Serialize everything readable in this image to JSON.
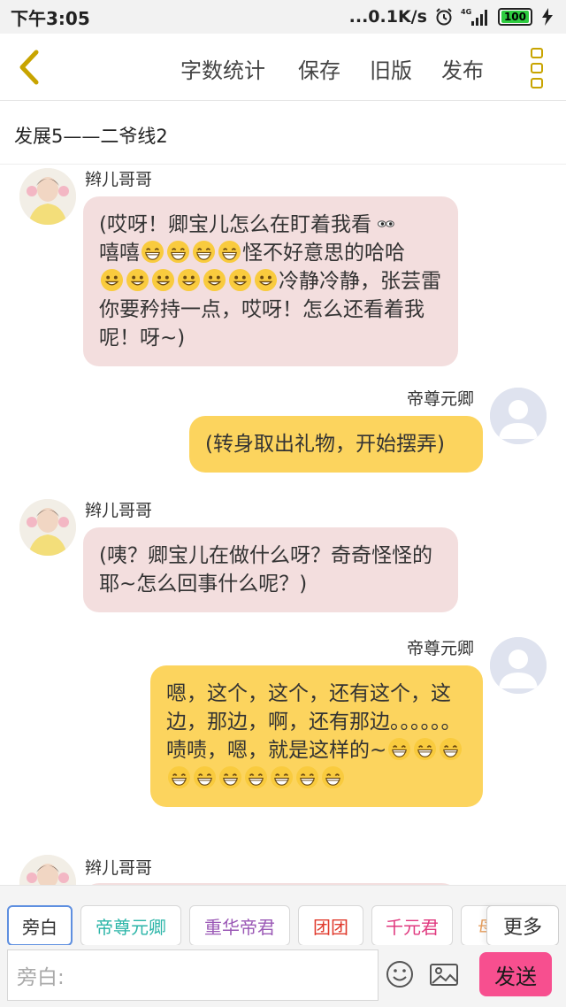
{
  "status_bar": {
    "time": "下午3:05",
    "network_speed": "...0.1K/s",
    "network_type": "4G",
    "battery": "100",
    "icons": [
      "alarm-icon",
      "signal-icon",
      "battery-icon",
      "charging-icon"
    ]
  },
  "toolbar": {
    "back_icon": "chevron-left-icon",
    "items": [
      "字数统计",
      "保存",
      "旧版",
      "发布"
    ],
    "more_icon": "more-vertical-icon"
  },
  "chapter": {
    "title": "发展5——二爷线2"
  },
  "messages": [
    {
      "side": "left",
      "sender": "辫儿哥哥",
      "avatar": "avatar-photo",
      "text_parts": [
        "(哎呀！卿宝儿怎么在盯着我看",
        "👀",
        "嘻嘻",
        "😁😁😁😁",
        "怪不好意思的哈哈",
        "😊😊😊😊😊😊😊",
        "冷静冷静，张芸雷你要矜持一点，哎呀！怎么还看着我呢！呀~)"
      ]
    },
    {
      "side": "right",
      "sender": "帝尊元卿",
      "avatar": "avatar-default",
      "text": "(转身取出礼物，开始摆弄)"
    },
    {
      "side": "left",
      "sender": "辫儿哥哥",
      "avatar": "avatar-photo",
      "text": "(咦？卿宝儿在做什么呀？奇奇怪怪的耶~怎么回事什么呢？)"
    },
    {
      "side": "right",
      "sender": "帝尊元卿",
      "avatar": "avatar-default",
      "text_parts": [
        "嗯，这个，这个，还有这个，这边，那边，啊，还有那边。。。。。。啧啧，嗯，就是这样的~",
        "😁😁😁😁😁😁😁😁😁😁"
      ]
    },
    {
      "side": "left",
      "sender": "辫儿哥哥",
      "avatar": "avatar-photo",
      "text": ""
    }
  ],
  "speakers": [
    {
      "label": "旁白",
      "color": "#333333",
      "active": true
    },
    {
      "label": "帝尊元卿",
      "color": "#2bb5a8",
      "active": false
    },
    {
      "label": "重华帝君",
      "color": "#9b59b6",
      "active": false
    },
    {
      "label": "团团",
      "color": "#e0392b",
      "active": false
    },
    {
      "label": "千元君",
      "color": "#e0397f",
      "active": false
    },
    {
      "label": "母",
      "color": "#e8a060",
      "active": false
    }
  ],
  "more_label": "更多",
  "input": {
    "placeholder": "旁白:"
  },
  "emoji_icon": "smiley-icon",
  "image_icon": "image-icon",
  "send_label": "发送",
  "colors": {
    "accent_yellow": "#fcd45e",
    "bubble_pink": "#f3dede",
    "send_pink": "#f74f8f",
    "active_chip_border": "#5e8fe0"
  }
}
